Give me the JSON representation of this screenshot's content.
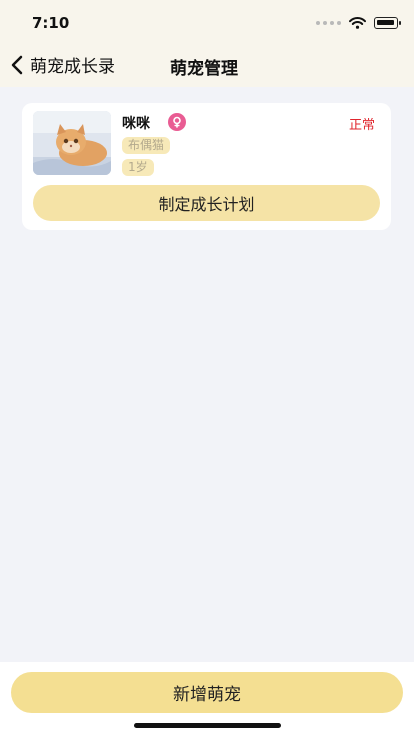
{
  "status_bar": {
    "time": "7:10",
    "icons": [
      "signal-dots-icon",
      "wifi-icon",
      "battery-icon"
    ]
  },
  "nav": {
    "back_label": "萌宠成长录",
    "title": "萌宠管理",
    "icon": "chevron-left-icon"
  },
  "pets": [
    {
      "name": "咪咪",
      "gender_icon": "female-icon",
      "status": "正常",
      "breed": "布偶猫",
      "age": "1岁",
      "plan_button_label": "制定成长计划"
    }
  ],
  "bottom": {
    "add_button_label": "新增萌宠"
  },
  "colors": {
    "header_bg": "#f8f5ec",
    "page_bg": "#f2f3f8",
    "button_yellow": "#f4df92",
    "status_red": "#e0262e",
    "gender_pink": "#e95c93",
    "tag_bg": "#f7e9b8"
  }
}
